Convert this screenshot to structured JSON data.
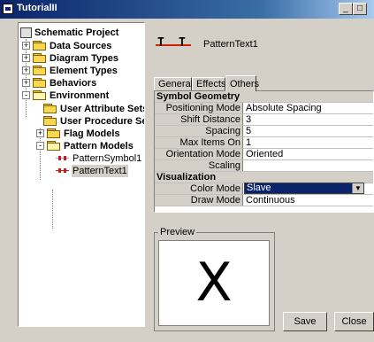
{
  "window": {
    "title": "TutorialII",
    "minimize": "_",
    "maximize": "□"
  },
  "tree": {
    "root": "Schematic Project",
    "items": [
      {
        "label": "Data Sources",
        "expander": "+"
      },
      {
        "label": "Diagram Types",
        "expander": "+"
      },
      {
        "label": "Element Types",
        "expander": "+"
      },
      {
        "label": "Behaviors",
        "expander": "+"
      },
      {
        "label": "Environment",
        "expander": "-"
      },
      {
        "label": "User Attribute Sets"
      },
      {
        "label": "User Procedure Sets"
      },
      {
        "label": "Flag Models",
        "expander": "+"
      },
      {
        "label": "Pattern Models",
        "expander": "-"
      },
      {
        "label": "PatternSymbol1"
      },
      {
        "label": "PatternText1"
      }
    ]
  },
  "header": {
    "icon_text_left": "T",
    "icon_text_right": "T",
    "name": "PatternText1"
  },
  "tabs": [
    "General",
    "Effects",
    "Others"
  ],
  "properties": {
    "section1": "Symbol Geometry",
    "rows1": [
      {
        "key": "Positioning Mode",
        "value": "Absolute Spacing"
      },
      {
        "key": "Shift Distance",
        "value": "3"
      },
      {
        "key": "Spacing",
        "value": "5"
      },
      {
        "key": "Max Items On Segment",
        "value": "1"
      },
      {
        "key": "Orientation Mode",
        "value": "Oriented"
      },
      {
        "key": "Scaling",
        "value": ""
      }
    ],
    "section2": "Visualization",
    "color_mode": {
      "key": "Color Mode",
      "value": "Slave",
      "arrow": "▼"
    },
    "draw_mode": {
      "key": "Draw Mode",
      "value": "Continuous"
    }
  },
  "preview": {
    "label": "Preview",
    "glyph": "X"
  },
  "buttons": {
    "save": "Save",
    "close": "Close"
  }
}
